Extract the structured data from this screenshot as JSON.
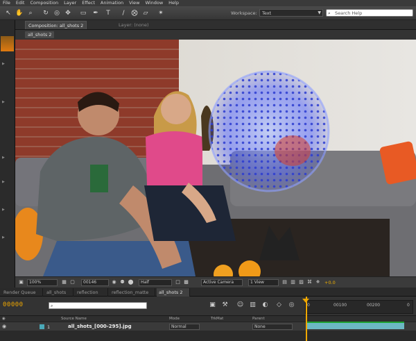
{
  "menubar": {
    "items": [
      "File",
      "Edit",
      "Composition",
      "Layer",
      "Effect",
      "Animation",
      "View",
      "Window",
      "Help"
    ]
  },
  "toolbar": {
    "tools": [
      "selection-icon",
      "hand-icon",
      "zoom-icon",
      "rotate-icon",
      "camera-orbit-icon",
      "pan-behind-icon",
      "rectangle-mask-icon",
      "pen-icon",
      "type-icon",
      "brush-icon",
      "clone-stamp-icon",
      "eraser-icon",
      "puppet-pin-icon"
    ],
    "workspace_label": "Workspace:",
    "workspace_value": "Text",
    "search_placeholder": "Search Help"
  },
  "comp_tabs": {
    "active": "Composition: all_shots 2",
    "layer": "Layer: (none)"
  },
  "sub_tab": "all_shots 2",
  "viewer_bar": {
    "zoom": "100%",
    "timecode": "00146",
    "resolution": "Half",
    "camera": "Active Camera",
    "views": "1 View",
    "exposure": "+0.0"
  },
  "timeline_tabs": [
    "Render Queue",
    "all_shots",
    "reflection",
    "reflection_matte",
    "all_shots 2"
  ],
  "timeline_active_tab": "all_shots 2",
  "timeline": {
    "timecode": "00000",
    "ruler": [
      "0",
      "00100",
      "00200",
      "0"
    ]
  },
  "columns": {
    "source_name": "Source Name",
    "mode": "Mode",
    "trkmat": "TrkMat",
    "parent": "Parent"
  },
  "layer": {
    "number": "1",
    "name": "all_shots_[000-295].jpg",
    "mode": "Normal",
    "parent": "None"
  },
  "colors": {
    "accent": "#f0a800",
    "track": "#6cb8c4",
    "workarea": "#1ea030"
  }
}
